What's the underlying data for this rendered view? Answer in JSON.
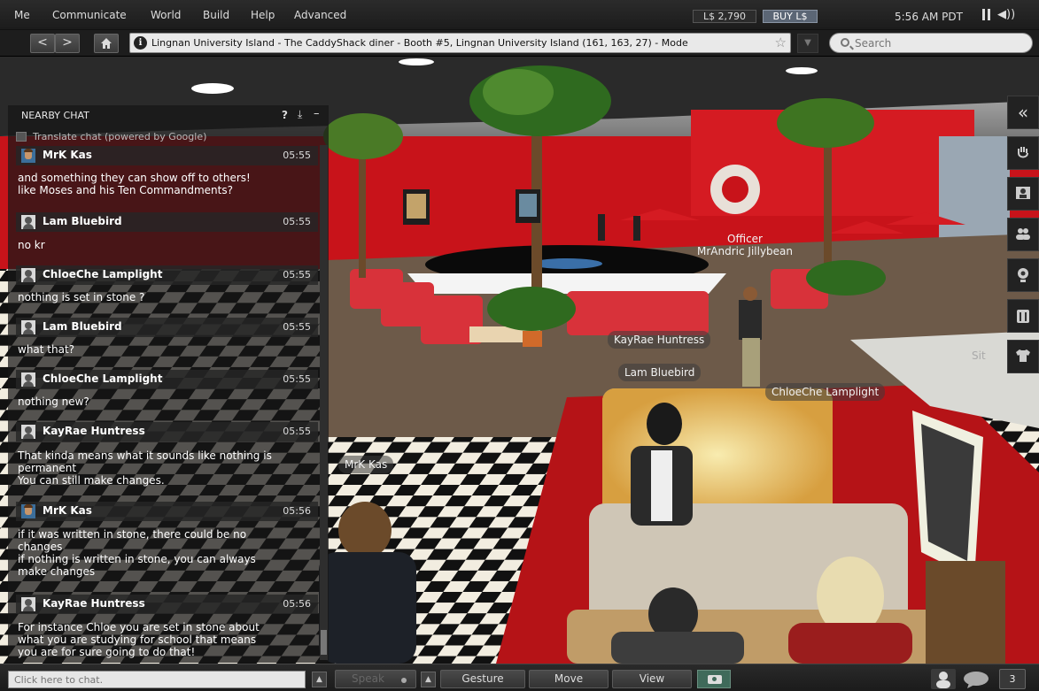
{
  "menu": {
    "items": [
      "Me",
      "Communicate",
      "World",
      "Build",
      "Help",
      "Advanced"
    ],
    "balance": "L$ 2,790",
    "buy_label": "BUY L$",
    "clock": "5:56 AM PDT"
  },
  "nav": {
    "back_label": "<",
    "forward_label": ">",
    "location": "Lingnan University Island - The CaddyShack diner - Booth #5, Lingnan University Island (161, 163, 27) - Mode",
    "search_placeholder": "Search"
  },
  "scene": {
    "nametags": {
      "officer": "Officer\nMrAndric Jillybean",
      "kayrae": "KayRae Huntress",
      "lam": "Lam Bluebird",
      "chloeche": "ChloeChe Lamplight",
      "mrk": "MrK Kas",
      "sit": "Sit"
    }
  },
  "chat": {
    "title": "NEARBY CHAT",
    "help": "?",
    "translate_label": "Translate chat (powered by Google)",
    "messages": [
      {
        "name": "MrK Kas",
        "time": "05:55",
        "text": "and something they can show off to others!\nlike Moses and his Ten Commandments?"
      },
      {
        "name": "Lam Bluebird",
        "time": "05:55",
        "text": "no kr"
      },
      {
        "name": "ChloeChe Lamplight",
        "time": "05:55",
        "text": "nothing is set in stone ?"
      },
      {
        "name": "Lam Bluebird",
        "time": "05:55",
        "text": "what that?"
      },
      {
        "name": "ChloeChe Lamplight",
        "time": "05:55",
        "text": "nothing new?"
      },
      {
        "name": "KayRae Huntress",
        "time": "05:55",
        "text": "That kinda means what it sounds like nothing is\npermanent\nYou can still make changes."
      },
      {
        "name": "MrK Kas",
        "time": "05:56",
        "text": "if it was written in stone, there could be no\nchanges\nif nothing is written in stone, you can always\nmake changes"
      },
      {
        "name": "KayRae Huntress",
        "time": "05:56",
        "text": "For instance Chloe you are set in stone about\nwhat you are studying for school that means\nyou are for sure going to do that!"
      }
    ]
  },
  "bottom": {
    "chat_placeholder": "Click here to chat.",
    "speak_label": "Speak",
    "gesture_label": "Gesture",
    "move_label": "Move",
    "view_label": "View",
    "notification_count": "3"
  },
  "colors": {
    "ui_dark": "#1c1c1c",
    "diner_red": "#c8131a",
    "floor_black": "#111111",
    "floor_white": "#f2ede0"
  }
}
